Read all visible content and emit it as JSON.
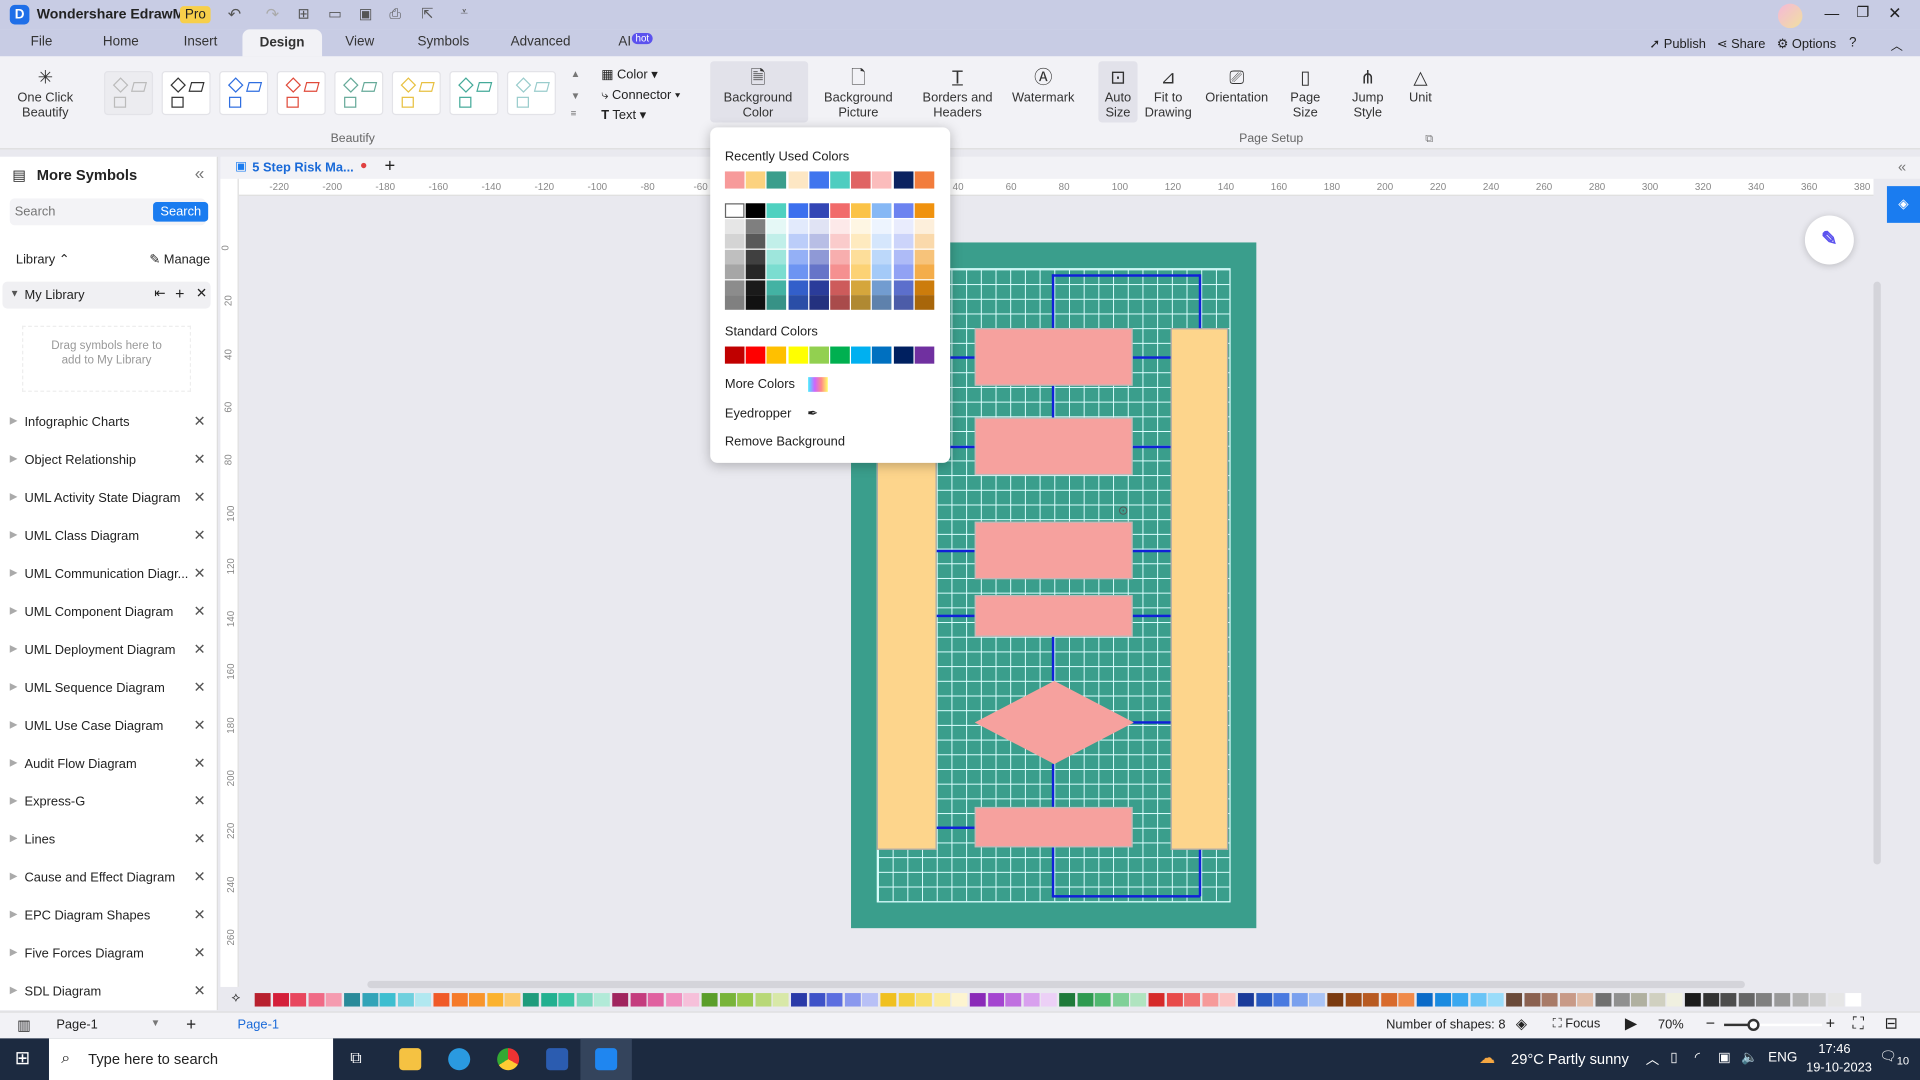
{
  "app": {
    "title": "Wondershare EdrawMax",
    "badge": "Pro"
  },
  "menu_tabs": [
    "File",
    "Home",
    "Insert",
    "Design",
    "View",
    "Symbols",
    "Advanced",
    "AI"
  ],
  "ai_badge": "hot",
  "top_right": {
    "publish": "Publish",
    "share": "Share",
    "options": "Options"
  },
  "ribbon": {
    "one_click": "One Click Beautify",
    "color": "Color",
    "connector": "Connector",
    "text": "Text",
    "beautify_label": "Beautify",
    "buttons": [
      "Background Color",
      "Background Picture",
      "Borders and Headers",
      "Watermark",
      "Auto Size",
      "Fit to Drawing",
      "Orientation",
      "Page Size",
      "Jump Style",
      "Unit"
    ],
    "page_setup_label": "Page Setup"
  },
  "sidebar": {
    "title": "More Symbols",
    "search_placeholder": "Search",
    "search_button": "Search",
    "library": "Library",
    "manage": "Manage",
    "my_library": "My Library",
    "drag_hint": "Drag symbols here to add to My Library",
    "items": [
      "Infographic Charts",
      "Object Relationship",
      "UML Activity State Diagram",
      "UML Class Diagram",
      "UML Communication Diagr...",
      "UML Component Diagram",
      "UML Deployment Diagram",
      "UML Sequence Diagram",
      "UML Use Case Diagram",
      "Audit Flow Diagram",
      "Express-G",
      "Lines",
      "Cause and Effect Diagram",
      "EPC Diagram Shapes",
      "Five Forces Diagram",
      "SDL Diagram"
    ]
  },
  "document_tab": "5 Step Risk Ma...",
  "ruler_top": [
    "-220",
    "-200",
    "-180",
    "-160",
    "-140",
    "-120",
    "-100",
    "-80",
    "-60",
    "40",
    "60",
    "80",
    "100",
    "120",
    "140",
    "160",
    "180",
    "200",
    "220",
    "240",
    "260",
    "280",
    "300",
    "320",
    "340",
    "360",
    "380"
  ],
  "ruler_left": [
    "0",
    "20",
    "40",
    "60",
    "80",
    "100",
    "120",
    "140",
    "160",
    "180",
    "200",
    "220",
    "240",
    "260"
  ],
  "color_popup": {
    "recent_title": "Recently Used Colors",
    "recent": [
      "#f79a9a",
      "#fcd27f",
      "#3a9e8c",
      "#fde7c4",
      "#3f75ee",
      "#4ecdc0",
      "#e06464",
      "#fbbcbc",
      "#0c2360",
      "#f27c3c"
    ],
    "theme_top": [
      "#ffffff",
      "#000000",
      "#4fd1c0",
      "#3c70ee",
      "#3346b5",
      "#f16b6b",
      "#fbc347",
      "#86b8f5",
      "#6c83f0",
      "#f0920e"
    ],
    "standard_title": "Standard Colors",
    "standard": [
      "#c00000",
      "#ff0000",
      "#ffc000",
      "#ffff00",
      "#92d050",
      "#00b050",
      "#00b0f0",
      "#0070c0",
      "#002060",
      "#7030a0"
    ],
    "more_colors": "More Colors",
    "eyedropper": "Eyedropper",
    "remove_bg": "Remove Background"
  },
  "palette": [
    "#b8202e",
    "#d41f3a",
    "#e8465e",
    "#f06a86",
    "#f59bb0",
    "#2a8a9a",
    "#32a4b8",
    "#3dbed0",
    "#6fd0de",
    "#b1e8f0",
    "#f05a28",
    "#f57a2a",
    "#f8952c",
    "#fbb22e",
    "#fcca6e",
    "#1f9c7c",
    "#22b090",
    "#3cc4a4",
    "#7cd8c0",
    "#b2ead8",
    "#a0245e",
    "#c43c7e",
    "#e060a0",
    "#f090c0",
    "#f6c0da",
    "#5a9e2a",
    "#78b43a",
    "#98c84e",
    "#b8d878",
    "#d8e8a8",
    "#2a3aa8",
    "#3e52c8",
    "#5c6ee0",
    "#8a98ee",
    "#b8c0f6",
    "#f0c020",
    "#f4d040",
    "#f8e070",
    "#fbeca0",
    "#fdf4d0",
    "#8a2ab8",
    "#a444d0",
    "#c070e0",
    "#d8a0ee",
    "#ecd0f6",
    "#1e7a3a",
    "#2e9a50",
    "#50b870",
    "#80d098",
    "#b0e4c0",
    "#d62a2a",
    "#e84a4a",
    "#f07070",
    "#f69a9a",
    "#fbc4c4",
    "#1a3a9a",
    "#2a5ac0",
    "#4a7ae0",
    "#7aa0ee",
    "#aac4f6",
    "#7a3a10",
    "#9a4a18",
    "#b85a22",
    "#d86a2c",
    "#f08a4a",
    "#0a6ac8",
    "#1a8ae0",
    "#3aa8f0",
    "#6ac4f6",
    "#9adcfa",
    "#6a4a3a",
    "#8a6050",
    "#a87a68",
    "#c89a88",
    "#e0bca8",
    "#707070",
    "#909090",
    "#b0b0a0",
    "#d0d0c0",
    "#f0f0e0",
    "#1a1a1a",
    "#333333",
    "#4d4d4d",
    "#666666",
    "#808080",
    "#999999",
    "#b3b3b3",
    "#cccccc",
    "#e6e6e6",
    "#ffffff"
  ],
  "status": {
    "page_select": "Page-1",
    "page_tab": "Page-1",
    "shapes": "Number of shapes: 8",
    "focus": "Focus",
    "zoom": "70%",
    "zoom_level": 0.3
  },
  "taskbar": {
    "search": "Type here to search",
    "weather": "29°C  Partly sunny",
    "lang": "ENG",
    "time": "17:46",
    "date": "19-10-2023",
    "notif": "10"
  }
}
